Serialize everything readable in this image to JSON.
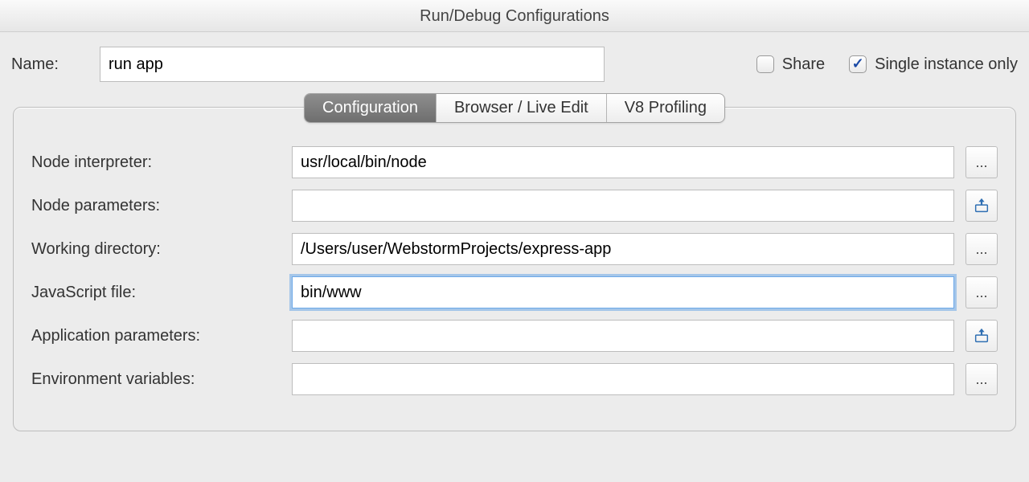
{
  "window": {
    "title": "Run/Debug Configurations"
  },
  "header": {
    "name_label": "Name:",
    "name_value": "run app",
    "share_label": "Share",
    "share_checked": false,
    "single_instance_label": "Single instance only",
    "single_instance_checked": true
  },
  "tabs": {
    "configuration": "Configuration",
    "browser_live_edit": "Browser / Live Edit",
    "v8_profiling": "V8 Profiling",
    "active": "configuration"
  },
  "form": {
    "node_interpreter": {
      "label": "Node interpreter:",
      "value": "usr/local/bin/node"
    },
    "node_parameters": {
      "label": "Node parameters:",
      "value": ""
    },
    "working_directory": {
      "label": "Working directory:",
      "value": "/Users/user/WebstormProjects/express-app"
    },
    "javascript_file": {
      "label": "JavaScript file:",
      "value": "bin/www"
    },
    "application_parameters": {
      "label": "Application parameters:",
      "value": ""
    },
    "environment_variables": {
      "label": "Environment variables:",
      "value": ""
    }
  },
  "icons": {
    "ellipsis": "...",
    "expand": "expand-macro"
  }
}
